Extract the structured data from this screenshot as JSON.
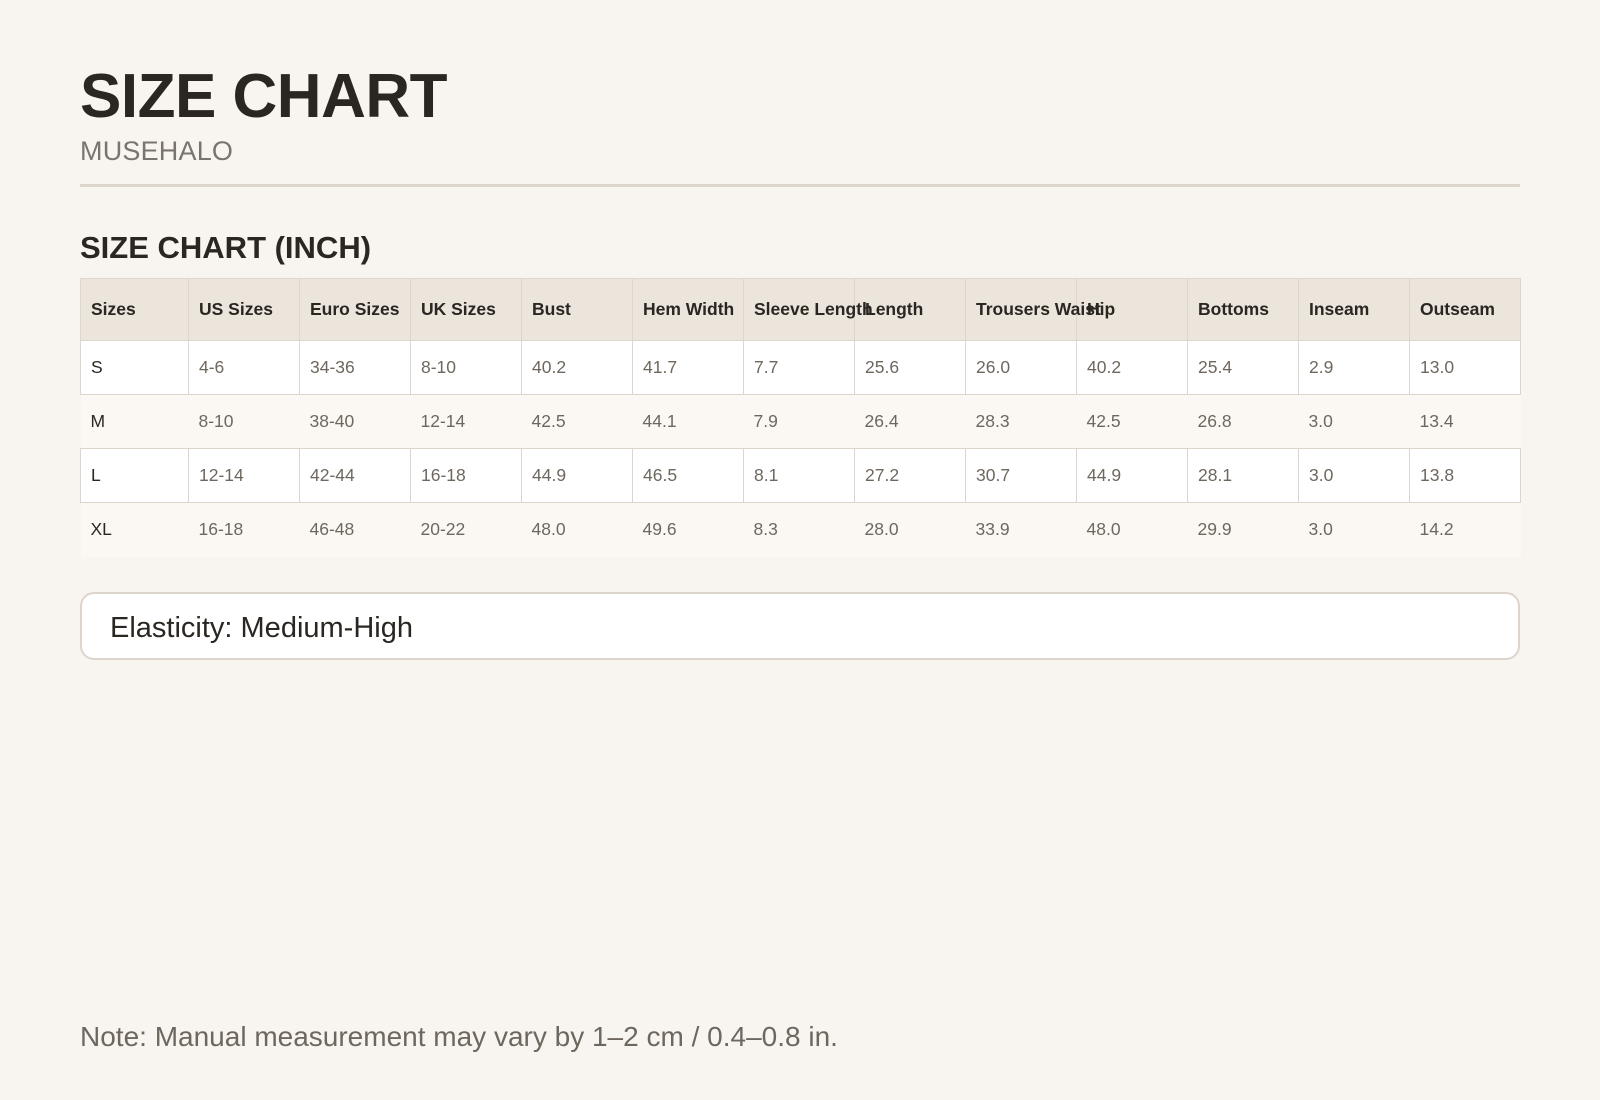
{
  "header": {
    "title": "SIZE CHART",
    "brand": "MUSEHALO"
  },
  "section": {
    "title": "SIZE CHART (INCH)"
  },
  "table": {
    "columns": [
      "Sizes",
      "US Sizes",
      "Euro Sizes",
      "UK Sizes",
      "Bust",
      "Hem Width",
      "Sleeve Length",
      "Length",
      "Trousers Waist",
      "Hip",
      "Bottoms",
      "Inseam",
      "Outseam"
    ],
    "rows": [
      [
        "S",
        "4-6",
        "34-36",
        "8-10",
        "40.2",
        "41.7",
        "7.7",
        "25.6",
        "26.0",
        "40.2",
        "25.4",
        "2.9",
        "13.0"
      ],
      [
        "M",
        "8-10",
        "38-40",
        "12-14",
        "42.5",
        "44.1",
        "7.9",
        "26.4",
        "28.3",
        "42.5",
        "26.8",
        "3.0",
        "13.4"
      ],
      [
        "L",
        "12-14",
        "42-44",
        "16-18",
        "44.9",
        "46.5",
        "8.1",
        "27.2",
        "30.7",
        "44.9",
        "28.1",
        "3.0",
        "13.8"
      ],
      [
        "XL",
        "16-18",
        "46-48",
        "20-22",
        "48.0",
        "49.6",
        "8.3",
        "28.0",
        "33.9",
        "48.0",
        "29.9",
        "3.0",
        "14.2"
      ]
    ]
  },
  "elasticity": {
    "text": "Elasticity: Medium-High"
  },
  "footer": {
    "note": "Note: Manual measurement may vary by 1–2 cm / 0.4–0.8 in."
  },
  "colors": {
    "background": "#f8f5f0",
    "header_row": "#ebe5dc",
    "text_dark": "#2a2621",
    "text_muted": "#6e675e",
    "border": "#ddd6cc"
  }
}
